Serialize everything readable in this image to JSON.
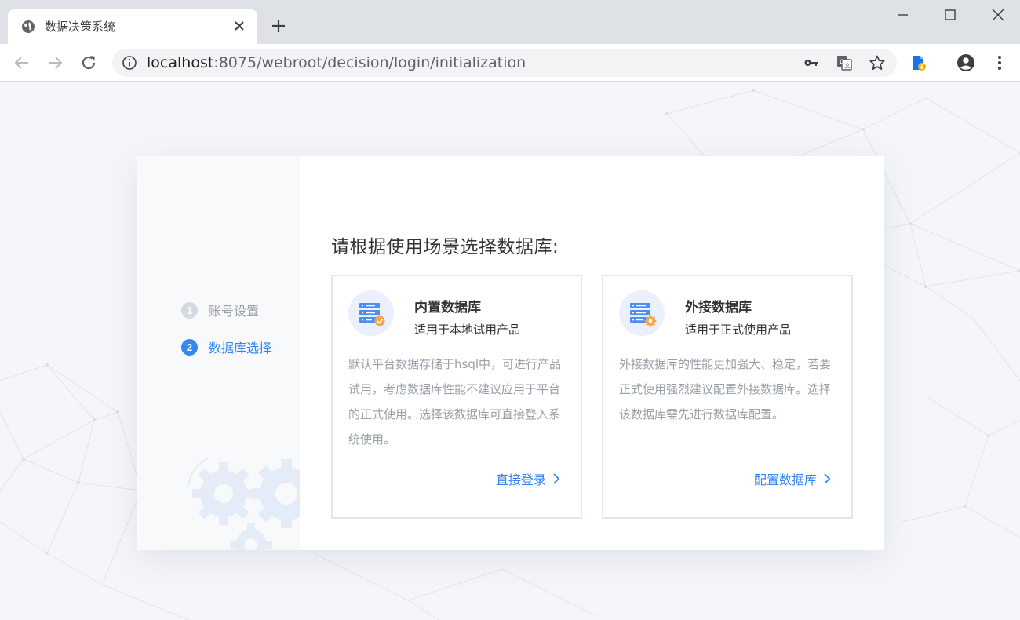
{
  "browser": {
    "tab_title": "数据决策系统",
    "url_host": "localhost",
    "url_rest": ":8075/webroot/decision/login/initialization"
  },
  "sidebar": {
    "steps": [
      {
        "number": "1",
        "label": "账号设置",
        "state": "done"
      },
      {
        "number": "2",
        "label": "数据库选择",
        "state": "active"
      }
    ]
  },
  "main": {
    "title": "请根据使用场景选择数据库:",
    "options": [
      {
        "name": "内置数据库",
        "subtitle": "适用于本地试用产品",
        "description": "默认平台数据存储于hsql中，可进行产品试用，考虑数据库性能不建议应用于平台的正式使用。选择该数据库可直接登入系统使用。",
        "action": "直接登录",
        "icon": "server-check-icon"
      },
      {
        "name": "外接数据库",
        "subtitle": "适用于正式使用产品",
        "description": "外接数据库的性能更加强大、稳定，若要正式使用强烈建议配置外接数据库。选择该数据库需先进行数据库配置。",
        "action": "配置数据库",
        "icon": "server-gear-icon"
      }
    ]
  },
  "colors": {
    "accent": "#3685f2",
    "step_done": "#d5d9e0",
    "muted_text": "#9aa0a8"
  }
}
